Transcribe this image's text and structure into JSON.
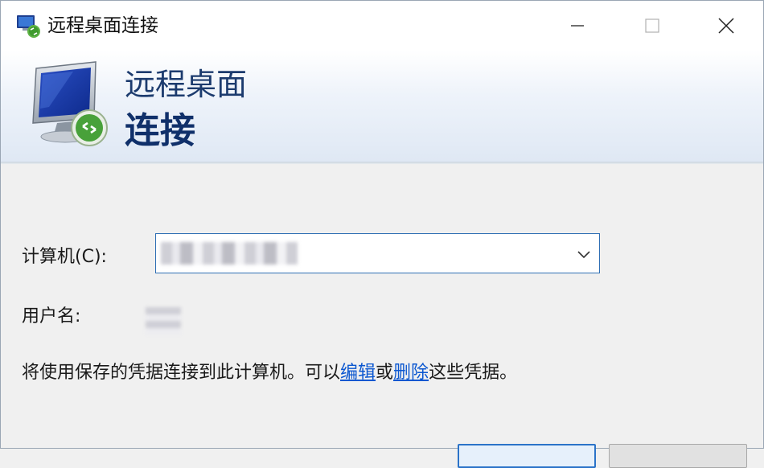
{
  "window": {
    "title": "远程桌面连接"
  },
  "banner": {
    "line1": "远程桌面",
    "line2": "连接"
  },
  "form": {
    "computer_label": "计算机(C):",
    "computer_value": "▒▒▒ ▒▒ ▒▒▒",
    "username_label": "用户名:",
    "username_value": "▒▒"
  },
  "info": {
    "prefix": "将使用保存的凭据连接到此计算机。可以",
    "edit_link": "编辑",
    "middle": "或",
    "delete_link": "删除",
    "suffix": "这些凭据。"
  },
  "icons": {
    "app": "remote-desktop-icon",
    "banner": "monitor-connection-icon",
    "minimize": "minimize-icon",
    "maximize": "maximize-icon",
    "close": "close-icon",
    "dropdown": "chevron-down-icon"
  },
  "colors": {
    "title_blue": "#10306a",
    "link_blue": "#0b57d0",
    "focus_border": "#2f6fb4"
  }
}
